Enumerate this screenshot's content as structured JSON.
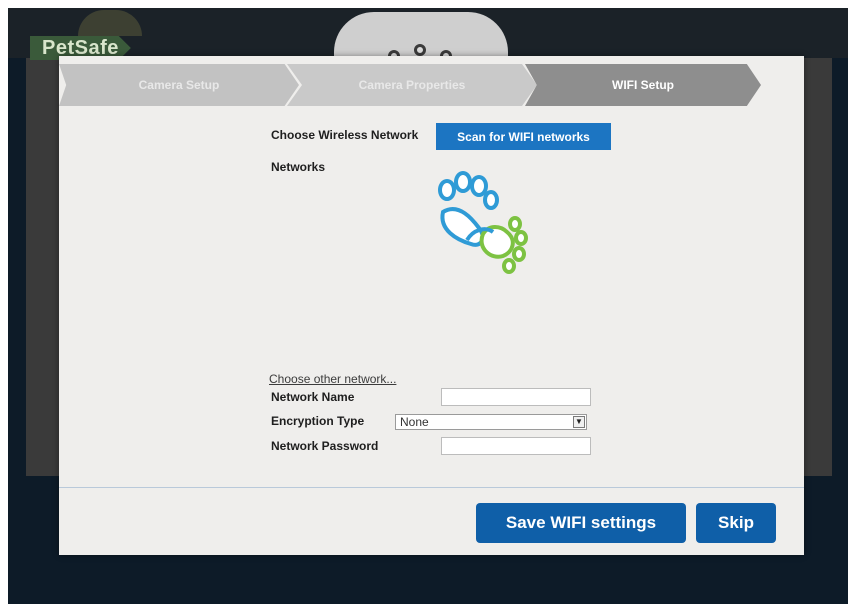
{
  "brand": {
    "logo_text": "PetSafe"
  },
  "wizard": {
    "steps": [
      "Camera Setup",
      "Camera Properties",
      "WIFI Setup"
    ],
    "active_step": "WIFI Setup"
  },
  "wifi": {
    "choose_label": "Choose Wireless Network",
    "scan_button": "Scan for WIFI networks",
    "networks_label": "Networks",
    "other_network_link": "Choose other network...",
    "network_name_label": "Network Name",
    "network_name_value": "",
    "encryption_label": "Encryption Type",
    "encryption_value": "None",
    "password_label": "Network Password",
    "password_value": ""
  },
  "footer": {
    "save_button": "Save WIFI settings",
    "skip_button": "Skip"
  },
  "colors": {
    "accent_blue": "#1c75c2",
    "button_blue": "#0f5fa8",
    "paw_blue": "#2f9bd6",
    "paw_green": "#7dc242"
  }
}
